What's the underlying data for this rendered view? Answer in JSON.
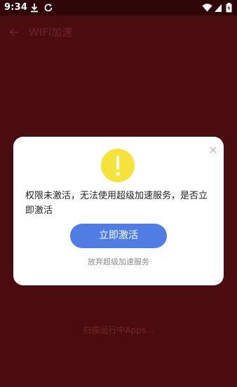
{
  "status_bar": {
    "time": "9:34",
    "icons": [
      "download-icon",
      "sync-icon",
      "wifi-icon",
      "signal-icon",
      "battery-icon"
    ]
  },
  "app_bar": {
    "back_icon": "arrow-left-icon",
    "title": "WIFI加速"
  },
  "background": {
    "scan_status": "扫描运行中Apps..."
  },
  "dialog": {
    "close_icon": "close-icon",
    "warning_icon": "exclamation-circle-icon",
    "message": "权限未激活，无法使用超级加速服务，是否立即激活",
    "primary_button": "立即激活",
    "secondary_link": "放弃超级加速服务"
  },
  "colors": {
    "background": "#4a0c0e",
    "status_bar": "#2f0708",
    "accent_button": "#4f7de3",
    "warning_yellow": "#f5e23a"
  }
}
